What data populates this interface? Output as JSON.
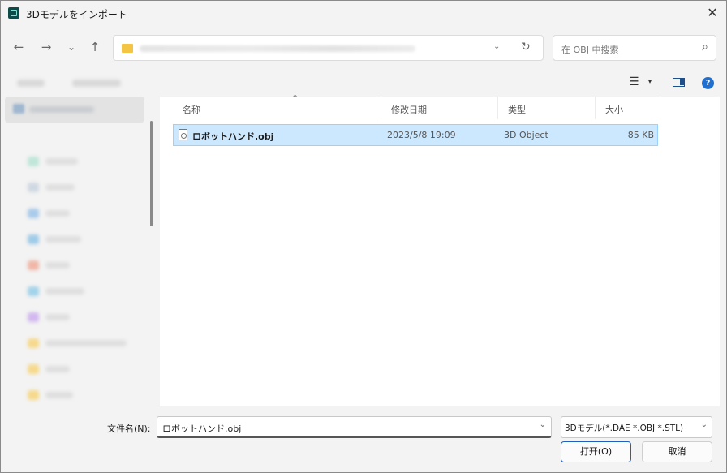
{
  "window": {
    "title": "3Dモデルをインポート",
    "close_glyph": "✕"
  },
  "nav": {
    "back": "←",
    "forward": "→",
    "recent": "⌄",
    "up": "↑",
    "dropdown": "⌄",
    "refresh": "↻"
  },
  "search": {
    "placeholder": "在 OBJ 中搜索",
    "icon": "⌕"
  },
  "toolbar": {
    "view_icon": "☰",
    "view_dropdown": "▾",
    "help_icon": "?"
  },
  "columns": {
    "name": "名称",
    "date": "修改日期",
    "type": "类型",
    "size": "大小"
  },
  "files": [
    {
      "name": "ロボットハンド.obj",
      "date": "2023/5/8 19:09",
      "type": "3D Object",
      "size": "85 KB"
    }
  ],
  "footer": {
    "filename_label": "文件名(N):",
    "filename_value": "ロボットハンド.obj",
    "filetype_value": "3Dモデル(*.DAE *.OBJ *.STL)",
    "open_button": "打开(O)",
    "cancel_button": "取消"
  },
  "colors": {
    "selection": "#cce8ff",
    "selection_border": "#99d1ff",
    "accent": "#1f5fbf"
  }
}
